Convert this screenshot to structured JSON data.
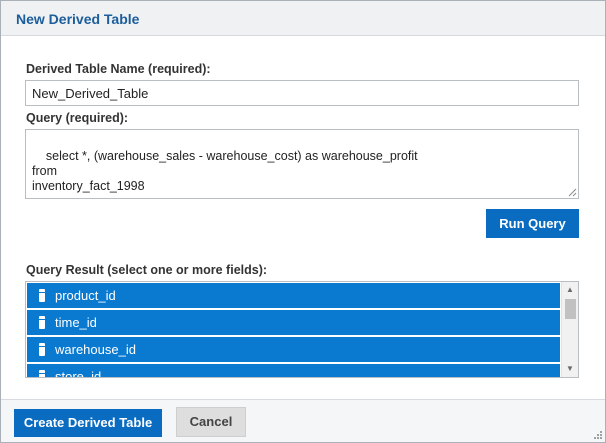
{
  "dialog": {
    "title": "New Derived Table"
  },
  "name_field": {
    "label": "Derived Table Name (required):",
    "value": "New_Derived_Table"
  },
  "query_field": {
    "label": "Query (required):",
    "value": "select *, (warehouse_sales - warehouse_cost) as warehouse_profit\nfrom\ninventory_fact_1998"
  },
  "run_query": {
    "label": "Run Query"
  },
  "result": {
    "label": "Query Result (select one or more fields):",
    "items": [
      {
        "label": "product_id",
        "icon": "field-icon",
        "selected": true
      },
      {
        "label": "time_id",
        "icon": "field-icon",
        "selected": true
      },
      {
        "label": "warehouse_id",
        "icon": "field-icon",
        "selected": true
      },
      {
        "label": "store_id",
        "icon": "field-icon",
        "selected": true
      }
    ]
  },
  "footer": {
    "create_label": "Create Derived Table",
    "cancel_label": "Cancel"
  },
  "colors": {
    "primary": "#0a6cc1",
    "selection": "#0a7ad1",
    "title_text": "#1c5d9b"
  }
}
